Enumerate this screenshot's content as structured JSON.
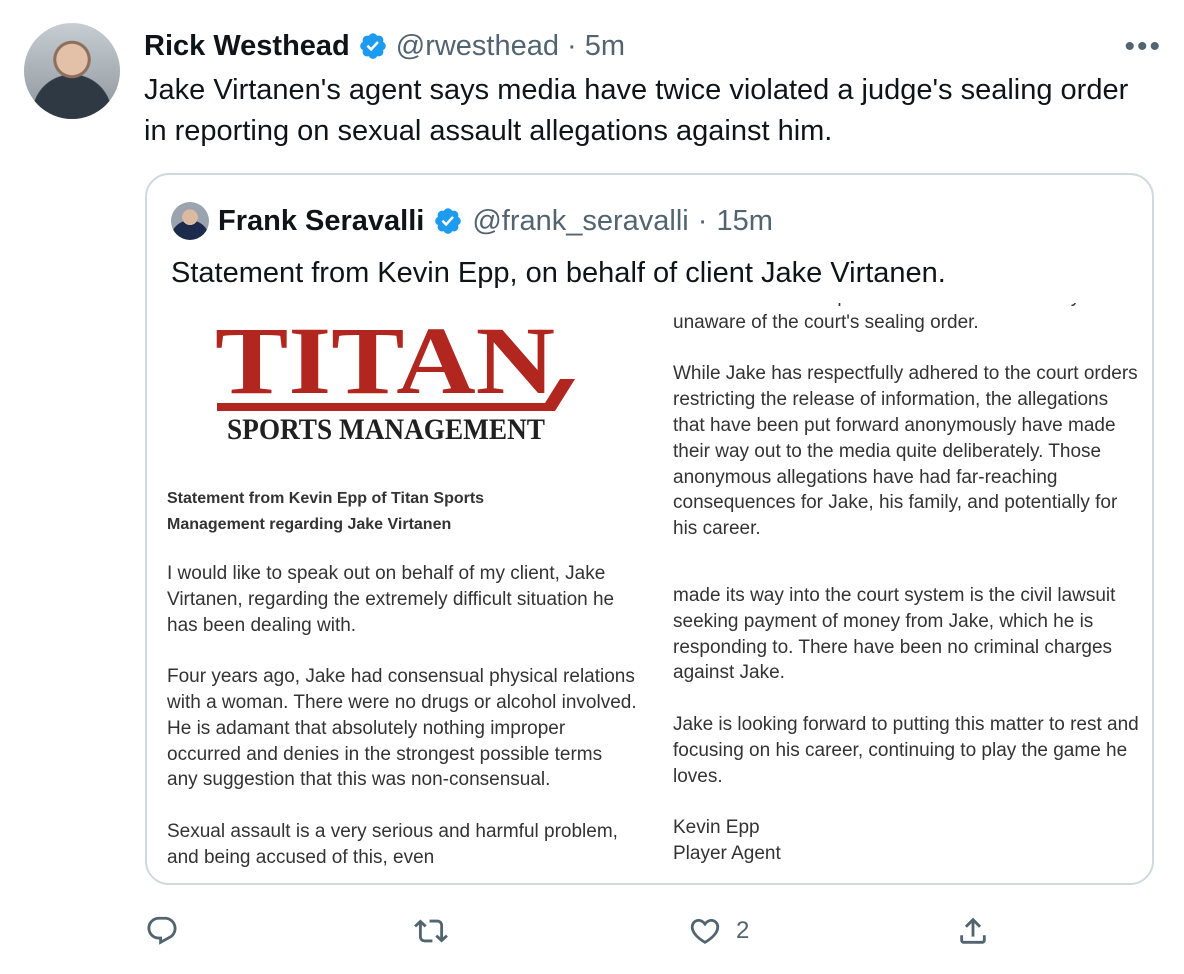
{
  "tweet": {
    "author_name": "Rick Westhead",
    "handle": "@rwesthead",
    "time": "5m",
    "separator": "·",
    "more_label": "•••",
    "text": "Jake Virtanen's agent says media have twice violated a judge's sealing order in reporting on sexual assault allegations against him."
  },
  "quoted": {
    "author_name": "Frank Seravalli",
    "handle": "@frank_seravalli",
    "time": "15m",
    "separator": "·",
    "text": "Statement from Kevin Epp, on behalf of client Jake Virtanen."
  },
  "document": {
    "logo_text_main": "TITAN",
    "logo_text_sub": "SPORTS MANAGEMENT",
    "heading": "Statement from Kevin Epp of Titan Sports Management regarding Jake Virtanen",
    "left_paragraphs": [
      "I would like to speak out on behalf of my client, Jake Virtanen, regarding the extremely difficult situation he has been dealing with.",
      "Four years ago, Jake had consensual physical relations with a woman. There were no drugs or alcohol involved. He is adamant that absolutely nothing improper occurred and denies in the strongest possible terms any suggestion that this was non-consensual.",
      "Sexual assault is a very serious and harmful problem, and being accused of this, even"
    ],
    "right_top_paragraphs": [
      "their source. The reporters were almost certainly unaware of the court's sealing order.",
      "While Jake has respectfully adhered to the court orders restricting the release of information, the allegations that have been put forward anonymously have made their way out to the media quite deliberately. Those anonymous allegations have had far-reaching consequences for Jake, his family, and potentially for his career."
    ],
    "right_bottom_paragraphs": [
      "made its way into the court system is the civil lawsuit seeking payment of money from Jake, which he is responding to. There have been no criminal charges against Jake.",
      "Jake is looking forward to putting this matter to rest and focusing on his career, continuing to play the game he loves."
    ],
    "signature_name": "Kevin Epp",
    "signature_title": "Player Agent"
  },
  "actions": {
    "like_count": "2"
  },
  "colors": {
    "verified_blue": "#1d9bf0",
    "logo_red": "#b1261e",
    "icon_gray": "#536471"
  }
}
